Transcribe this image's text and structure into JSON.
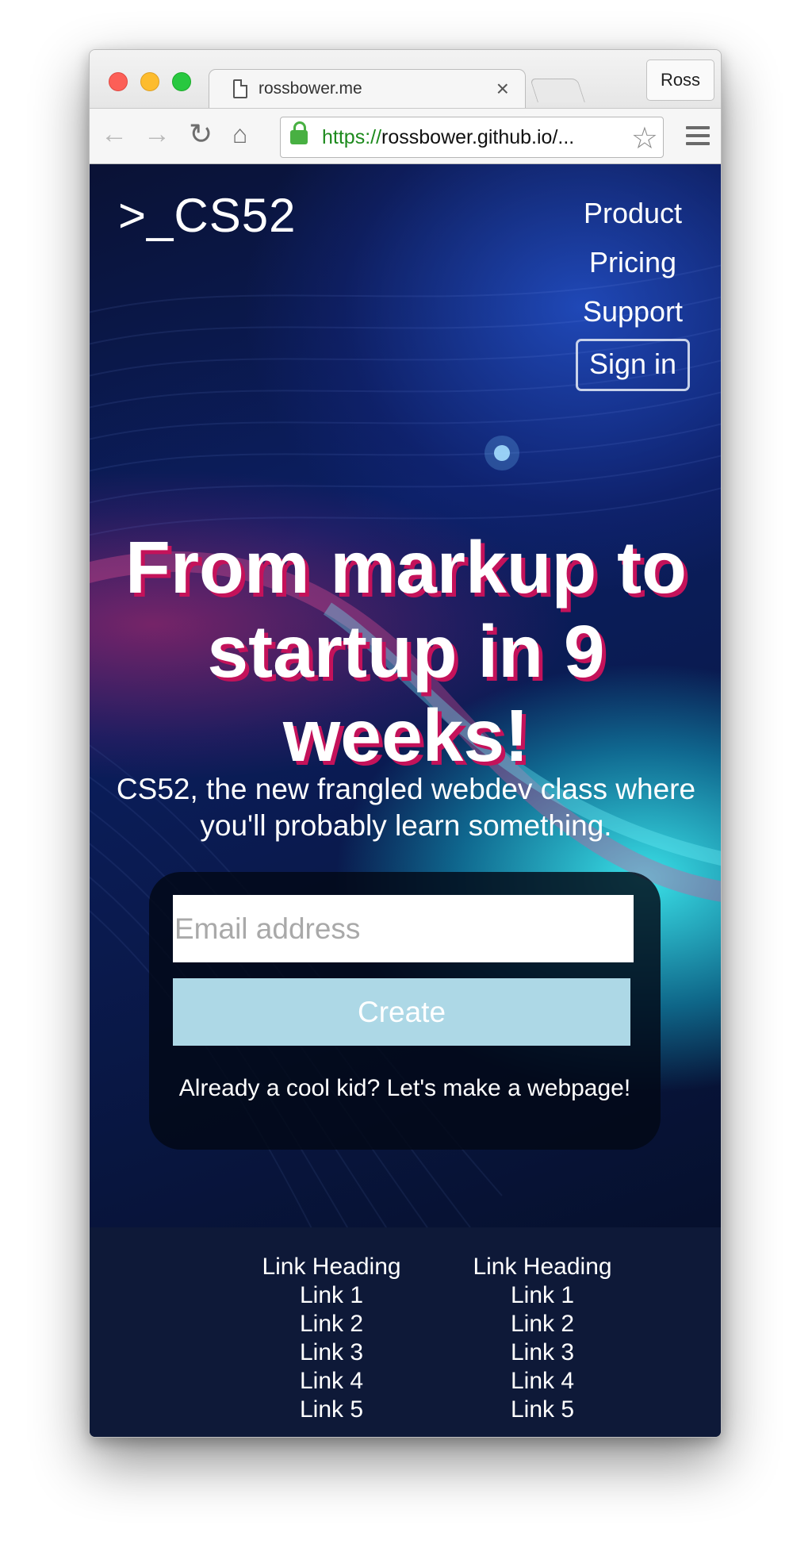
{
  "browser": {
    "tab_title": "rossbower.me",
    "tab_close_glyph": "×",
    "profile_name": "Ross",
    "url_scheme": "https",
    "url_sep": "://",
    "url_rest": "rossbower.github.io/...",
    "back_glyph": "←",
    "forward_glyph": "→",
    "reload_glyph": "↻",
    "home_glyph": "⌂",
    "star_glyph": "☆",
    "traffic_colors": [
      "#fc5f57",
      "#fdbc2e",
      "#28c840"
    ]
  },
  "header": {
    "logo": ">_CS52",
    "nav": {
      "product": "Product",
      "pricing": "Pricing",
      "support": "Support",
      "signin": "Sign in"
    }
  },
  "hero": {
    "headline": "From markup to startup in 9 weeks!",
    "subhead": "CS52, the new frangled webdev class where you'll probably learn something."
  },
  "signup": {
    "email_placeholder": "Email address",
    "create_label": "Create",
    "cool_kid_text": "Already a cool kid? Let's make a webpage!",
    "create_color": "#add8e6",
    "headline_shadow_color": "#c4125a"
  },
  "footer": {
    "columns": [
      {
        "heading": "Link Heading",
        "links": [
          "Link 1",
          "Link 2",
          "Link 3",
          "Link 4",
          "Link 5"
        ]
      },
      {
        "heading": "Link Heading",
        "links": [
          "Link 1",
          "Link 2",
          "Link 3",
          "Link 4",
          "Link 5"
        ]
      }
    ]
  }
}
